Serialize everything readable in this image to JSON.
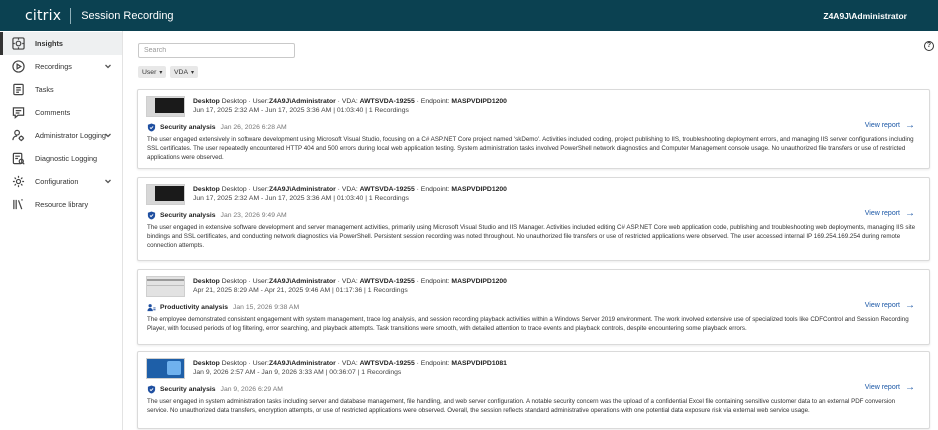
{
  "app": {
    "brand": "citrix",
    "title": "Session Recording",
    "user": "Z4A9J\\Administrator"
  },
  "sidebar": {
    "items": [
      {
        "label": "Insights",
        "icon": "insights-icon",
        "active": true
      },
      {
        "label": "Recordings",
        "icon": "play-circle-icon",
        "expandable": true
      },
      {
        "label": "Tasks",
        "icon": "tasks-icon"
      },
      {
        "label": "Comments",
        "icon": "comment-icon"
      },
      {
        "label": "Administrator Logging",
        "icon": "admin-user-icon",
        "expandable": true
      },
      {
        "label": "Diagnostic Logging",
        "icon": "diagnostic-icon"
      },
      {
        "label": "Configuration",
        "icon": "gear-icon",
        "expandable": true
      },
      {
        "label": "Resource library",
        "icon": "library-icon"
      }
    ]
  },
  "search": {
    "placeholder": "Search"
  },
  "help": {
    "label": "?"
  },
  "filters": [
    {
      "label": "User"
    },
    {
      "label": "VDA"
    }
  ],
  "cards": [
    {
      "meta_prefix": "Desktop · User:",
      "user": "Z4A9J\\Administrator",
      "vda_label": " · VDA: ",
      "vda": "AWTSVDA-19255",
      "endpoint_label": " · Endpoint: ",
      "endpoint": "MASPVDIPD1200",
      "time": "Jun 17, 2025 2:32 AM - Jun 17, 2025 3:36 AM | 01:03:40 | 1 Recordings",
      "analysis_type": "Security analysis",
      "analysis_date": "Jan 26, 2026 6:28 AM",
      "summary": "The user engaged extensively in software development using Microsoft Visual Studio, focusing on a C# ASP.NET Core project named 'skDemo'. Activities included coding, project publishing to IIS, troubleshooting deployment errors, and managing IIS server configurations including SSL certificates. The user repeatedly encountered HTTP 404 and 500 errors during local web application testing. System administration tasks involved PowerShell network diagnostics and Computer Management console usage. No unauthorized file transfers or use of restricted applications were observed.",
      "view_label": "View report",
      "thumb": "dark"
    },
    {
      "meta_prefix": "Desktop · User:",
      "user": "Z4A9J\\Administrator",
      "vda_label": " · VDA: ",
      "vda": "AWTSVDA-19255",
      "endpoint_label": " · Endpoint: ",
      "endpoint": "MASPVDIPD1200",
      "time": "Jun 17, 2025 2:32 AM - Jun 17, 2025 3:36 AM | 01:03:40 | 1 Recordings",
      "analysis_type": "Security analysis",
      "analysis_date": "Jan 23, 2026 9:49 AM",
      "summary": "The user engaged in extensive software development and server management activities, primarily using Microsoft Visual Studio and IIS Manager. Activities included editing C# ASP.NET Core web application code, publishing and troubleshooting web deployments, managing IIS site bindings and SSL certificates, and conducting network diagnostics via PowerShell. Persistent session recording was noted throughout. No unauthorized file transfers or use of restricted applications were observed. The user accessed internal IP 169.254.169.254 during remote connection attempts.",
      "view_label": "View report",
      "thumb": "dark"
    },
    {
      "meta_prefix": "Desktop · User:",
      "user": "Z4A9J\\Administrator",
      "vda_label": " · VDA: ",
      "vda": "AWTSVDA-19255",
      "endpoint_label": " · Endpoint: ",
      "endpoint": "MASPVDIPD1200",
      "time": "Apr 21, 2025 8:29 AM - Apr 21, 2025 9:46 AM | 01:17:36 | 1 Recordings",
      "analysis_type": "Productivity analysis",
      "analysis_date": "Jan 15, 2026 9:38 AM",
      "summary": "The employee demonstrated consistent engagement with system management, trace log analysis, and session recording playback activities within a Windows Server 2019 environment. The work involved extensive use of specialized tools like CDFControl and Session Recording Player, with focused periods of log filtering, error searching, and playback attempts. Task transitions were smooth, with detailed attention to trace events and playback controls, despite encountering some playback errors.",
      "view_label": "View report",
      "thumb": "gray"
    },
    {
      "meta_prefix": "Desktop · User:",
      "user": "Z4A9J\\Administrator",
      "vda_label": " · VDA: ",
      "vda": "AWTSVDA-19255",
      "endpoint_label": " · Endpoint: ",
      "endpoint": "MASPVDIPD1081",
      "time": "Jan 9, 2026 2:57 AM - Jan 9, 2026 3:33 AM | 00:36:07 | 1 Recordings",
      "analysis_type": "Security analysis",
      "analysis_date": "Jan 9, 2026 6:29 AM",
      "summary": "The user engaged in system administration tasks including server and database management, file handling, and web server configuration. A notable security concern was the upload of a confidential Excel file containing sensitive customer data to an external PDF conversion service. No unauthorized data transfers, encryption attempts, or use of restricted applications were observed. Overall, the session reflects standard administrative operations with one potential data exposure risk via external web service usage.",
      "view_label": "View report",
      "thumb": "blue"
    }
  ],
  "colors": {
    "topbar": "#0b4151",
    "link": "#1b57a6",
    "shield": "#1f4fa0"
  }
}
